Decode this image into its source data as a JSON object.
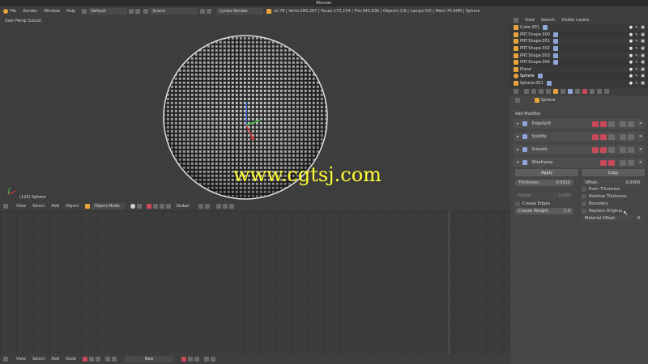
{
  "window": {
    "title": "Blender"
  },
  "menu": {
    "items": [
      "File",
      "Render",
      "Window",
      "Help"
    ],
    "layout": "Default",
    "scene": "Scene",
    "engine": "Cycles Render",
    "stats": "v2.78 | Verts:280,267 | Faces:173,154 | Tris:345,636 | Objects:1/9 | Lamps:0/0 | Mem:74.90M | Sphere"
  },
  "viewport": {
    "view_label": "User Persp (Local)",
    "object_label": "(120) Sphere",
    "watermark": "www.cgtsj.com",
    "header_items": [
      "View",
      "Select",
      "Add",
      "Object"
    ],
    "mode": "Object Mode",
    "orientation": "Global"
  },
  "node_editor": {
    "header_items": [
      "View",
      "Select",
      "Add",
      "Node"
    ],
    "new_label": "New"
  },
  "outliner": {
    "header_items": [
      "View",
      "Search",
      "Visible Layers"
    ],
    "rows": [
      "Cube.001",
      "PRT.Shape.000",
      "PRT.Shape.001",
      "PRT.Shape.002",
      "PRT.Shape.003",
      "PRT.Shape.004",
      "Plane",
      "Sphere",
      "Sphere.001"
    ]
  },
  "properties": {
    "object_name": "Sphere",
    "add_modifier": "Add Modifier",
    "modifiers": [
      "EdgeSplit",
      "Solidify",
      "Smooth",
      "Wireframe"
    ],
    "apply": "Apply",
    "copy": "Copy",
    "thickness_label": "Thickness:",
    "thickness_value": "0.0010",
    "offset_label": "Offset:",
    "offset_value": "0.0000",
    "factor_label": "Factor:",
    "factor_value": "0.000",
    "crease_edges": "Crease Edges",
    "crease_weight_label": "Crease Weight:",
    "crease_weight_value": "1.0",
    "even_thickness": "Even Thickness",
    "relative_thickness": "Relative Thickness",
    "boundary": "Boundary",
    "replace_original": "Replace Original",
    "material_offset_label": "Material Offset:",
    "material_offset_value": "0"
  },
  "colors": {
    "accent_red": "#c9495a",
    "object_orange": "#e8a33a"
  }
}
